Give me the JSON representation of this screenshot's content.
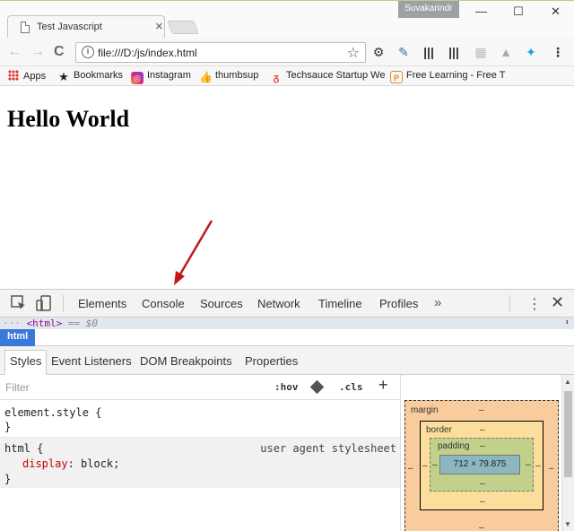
{
  "browser": {
    "tab_title": "Test Javascript",
    "tab_close": "×",
    "profile_name": "Suvakarindr",
    "window_controls": {
      "minimize": "—",
      "maximize": "☐",
      "close": "✕"
    },
    "nav": {
      "back": "←",
      "forward": "→",
      "reload": "C"
    },
    "url": "file:///D:/js/index.html",
    "bookmark_star": "☆",
    "extensions": [
      "gear-icon",
      "eyedropper-icon",
      "barcode-icon",
      "barcode-icon",
      "pattern-icon",
      "drive-icon",
      "twitter-icon",
      "menu-icon"
    ]
  },
  "bookmarks": [
    {
      "label": "Apps",
      "icon": "apps-grid-icon"
    },
    {
      "label": "Bookmarks",
      "icon": "star-icon"
    },
    {
      "label": "Instagram",
      "icon": "instagram-icon"
    },
    {
      "label": "thumbsup",
      "icon": "thumbs-up-icon"
    },
    {
      "label": "Techsauce Startup We",
      "icon": "techsauce-icon"
    },
    {
      "label": "Free Learning - Free T",
      "icon": "packt-icon"
    }
  ],
  "page": {
    "heading": "Hello World"
  },
  "devtools": {
    "tabs": [
      "Elements",
      "Console",
      "Sources",
      "Network",
      "Timeline",
      "Profiles"
    ],
    "selected_tab": "Elements",
    "more": "»",
    "kebab": "⋮",
    "close": "✕",
    "selected_node": {
      "dots": "···",
      "tag": "<html>",
      "suffix": "== $0"
    },
    "breadcrumb": "html",
    "subtabs": [
      "Styles",
      "Event Listeners",
      "DOM Breakpoints",
      "Properties"
    ],
    "filter_placeholder": "Filter",
    "hov": ":hov",
    "cls": ".cls",
    "add": "+",
    "rules": {
      "element_style": {
        "selector": "element.style {",
        "close": "}"
      },
      "html_rule": {
        "selector": "html {",
        "source": "user agent stylesheet",
        "property": "display",
        "value": "block;",
        "close": "}"
      }
    },
    "box_model": {
      "margin_label": "margin",
      "border_label": "border",
      "padding_label": "padding",
      "dash": "–",
      "content_size": "712 × 79.875"
    }
  },
  "colors": {
    "selected_blue": "#3879d9",
    "margin_orange": "#f9cc9d",
    "border_yellow": "#fddd9b",
    "padding_green": "#c3d08b",
    "content_blue": "#8cb6c0",
    "arrow_red": "#c01818"
  }
}
